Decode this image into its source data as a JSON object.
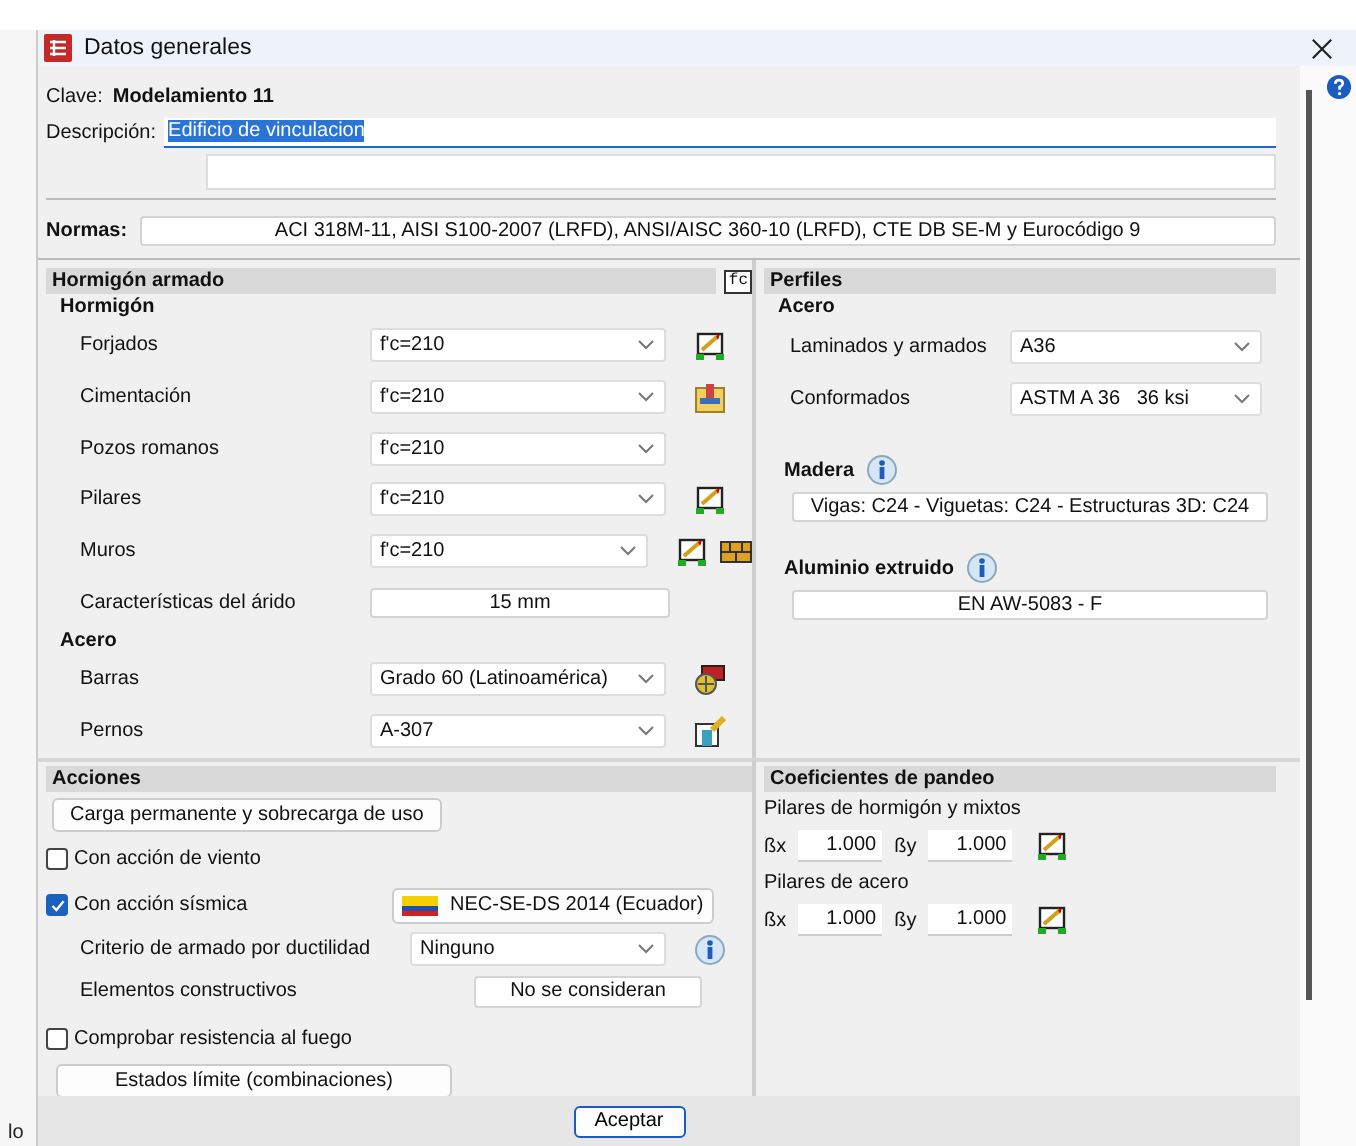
{
  "window": {
    "title": "Datos generales"
  },
  "behind_text": "lo",
  "clave": {
    "label": "Clave:",
    "value": "Modelamiento 11"
  },
  "descripcion": {
    "label": "Descripción:",
    "value": "Edificio de vinculacion",
    "text_selected": true
  },
  "normas": {
    "label": "Normas:",
    "value": "ACI 318M-11, AISI S100-2007 (LRFD), ANSI/AISC 360-10 (LRFD), CTE DB SE-M y Eurocódigo 9"
  },
  "hormigon_armado": {
    "title": "Hormigón armado",
    "header_icon_text": "fc",
    "groups": [
      {
        "title": "Hormigón",
        "rows": [
          {
            "kind": "select",
            "label": "Forjados",
            "value": "f'c=210",
            "icons": [
              {
                "kind": "frame"
              }
            ]
          },
          {
            "kind": "select",
            "label": "Cimentación",
            "value": "f'c=210",
            "icons": [
              {
                "kind": "footing"
              }
            ]
          },
          {
            "kind": "select",
            "label": "Pozos romanos",
            "value": "f'c=210",
            "icons": []
          },
          {
            "kind": "select",
            "label": "Pilares",
            "value": "f'c=210",
            "icons": [
              {
                "kind": "frame"
              }
            ]
          },
          {
            "kind": "select",
            "label": "Muros",
            "value": "f'c=210",
            "icons": [
              {
                "kind": "frame"
              },
              {
                "kind": "brick"
              }
            ]
          },
          {
            "kind": "field",
            "label": "Características del árido",
            "value": "15 mm",
            "icons": []
          }
        ]
      },
      {
        "title": "Acero",
        "rows": [
          {
            "kind": "select",
            "label": "Barras",
            "value": "Grado 60 (Latinoamérica)",
            "icons": [
              {
                "kind": "rebar"
              }
            ]
          },
          {
            "kind": "select",
            "label": "Pernos",
            "value": "A-307",
            "icons": [
              {
                "kind": "bolt"
              }
            ]
          }
        ]
      }
    ]
  },
  "perfiles": {
    "title": "Perfiles",
    "acero": {
      "title": "Acero",
      "rows": [
        {
          "label": "Laminados y armados",
          "value": "A36"
        },
        {
          "label": "Conformados",
          "value": "ASTM A 36   36 ksi"
        }
      ]
    },
    "madera": {
      "title": "Madera",
      "value": "Vigas: C24 - Viguetas: C24 - Estructuras 3D: C24"
    },
    "aluminio": {
      "title": "Aluminio extruido",
      "value": "EN AW-5083 - F"
    }
  },
  "acciones": {
    "title": "Acciones",
    "carga_button": "Carga permanente y sobrecarga de uso",
    "viento": {
      "label": "Con acción de viento",
      "checked": false
    },
    "sismica": {
      "label": "Con acción sísmica",
      "checked": true,
      "norm_button": "NEC-SE-DS 2014 (Ecuador)"
    },
    "criterio": {
      "label": "Criterio de armado por ductilidad",
      "value": "Ninguno"
    },
    "elementos": {
      "label": "Elementos constructivos",
      "value": "No se consideran"
    },
    "fuego": {
      "label": "Comprobar resistencia al fuego",
      "checked": false
    },
    "estados_button": "Estados límite (combinaciones)"
  },
  "pandeo": {
    "title": "Coeficientes de pandeo",
    "groups": [
      {
        "title": "Pilares de hormigón y mixtos",
        "bx_label": "ßx",
        "bx": "1.000",
        "by_label": "ßy",
        "by": "1.000"
      },
      {
        "title": "Pilares de acero",
        "bx_label": "ßx",
        "bx": "1.000",
        "by_label": "ßy",
        "by": "1.000"
      }
    ]
  },
  "footer": {
    "ok_button": "Aceptar"
  }
}
